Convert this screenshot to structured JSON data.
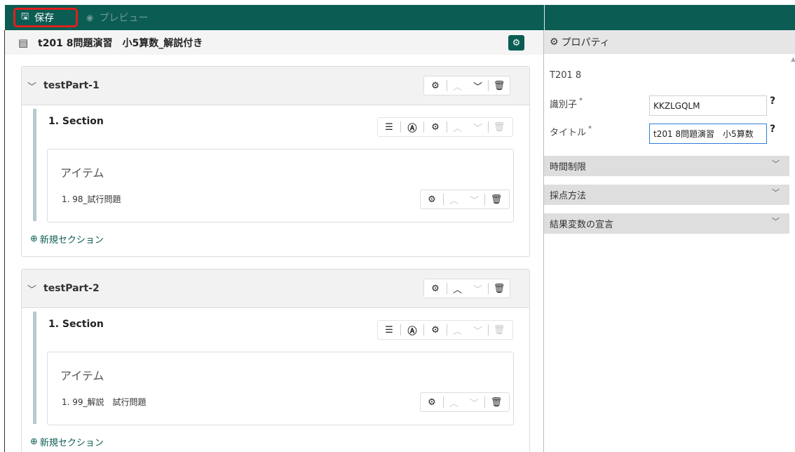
{
  "toolbar": {
    "save_label": "保存",
    "preview_label": "プレビュー"
  },
  "editor": {
    "title": "t201 8問題演習　小5算数_解説付き"
  },
  "test_parts": [
    {
      "name": "testPart-1",
      "section_title": "1. Section",
      "items_label": "アイテム",
      "item_name": "1. 98_試行問題",
      "new_section_label": "新規セクション"
    },
    {
      "name": "testPart-2",
      "section_title": "1. Section",
      "items_label": "アイテム",
      "item_name": "1. 99_解説　試行問題",
      "new_section_label": "新規セクション"
    }
  ],
  "properties": {
    "header": "プロパティ",
    "test_id": "T201 8",
    "identifier_label": "識別子",
    "identifier_value": "KKZLGQLM",
    "title_label": "タイトル",
    "title_value": "t201 8問題演習　小5算数",
    "required_mark": "*",
    "help_mark": "?",
    "sections": [
      "時間制限",
      "採点方法",
      "結果変数の宣言"
    ]
  },
  "colors": {
    "brand": "#0b5c52",
    "highlight": "#e0201c"
  }
}
